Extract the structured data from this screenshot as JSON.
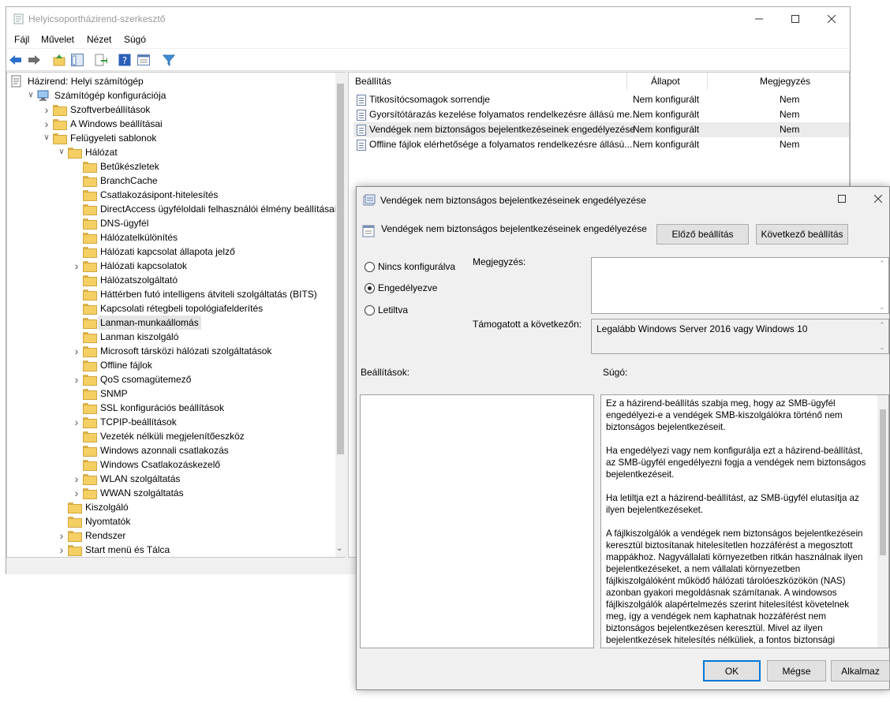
{
  "window": {
    "title": "Helyicsoportházirend-szerkesztő"
  },
  "menu": [
    "Fájl",
    "Művelet",
    "Nézet",
    "Súgó"
  ],
  "tree": {
    "root": "Házirend: Helyi számítógép",
    "computer_config": "Számítógép konfigurációja",
    "software": "Szoftverbeállítások",
    "windows_settings": "A Windows beállításai",
    "admin_templates": "Felügyeleti sablonok",
    "network": "Hálózat",
    "network_items": [
      "Betűkészletek",
      "BranchCache",
      "Csatlakozásipont-hitelesítés",
      "DirectAccess ügyféloldali felhasználói élmény beállításai",
      "DNS-ügyfél",
      "Hálózatelkülönítés",
      "Hálózati kapcsolat állapota jelző",
      "Hálózati kapcsolatok",
      "Hálózatszolgáltató",
      "Háttérben futó intelligens átviteli szolgáltatás (BITS)",
      "Kapcsolati rétegbeli topológiafelderítés",
      "Lanman-munkaállomás",
      "Lanman kiszolgáló",
      "Microsoft társközi hálózati szolgáltatások",
      "Offline fájlok",
      "QoS csomagütemező",
      "SNMP",
      "SSL konfigurációs beállítások",
      "TCPIP-beállítások",
      "Vezeték nélküli megjelenítőeszköz",
      "Windows azonnali csatlakozás",
      "Windows Csatlakozáskezelő",
      "WLAN szolgáltatás",
      "WWAN szolgáltatás"
    ],
    "after_network": [
      "Kiszolgáló",
      "Nyomtatók",
      "Rendszer",
      "Start menü és Tálca"
    ]
  },
  "list": {
    "headers": {
      "setting": "Beállítás",
      "state": "Állapot",
      "comment": "Megjegyzés"
    },
    "rows": [
      {
        "name": "Titkosítócsomagok sorrendje",
        "state": "Nem konfigurált",
        "comment": "Nem"
      },
      {
        "name": "Gyorsítótárazás kezelése folyamatos rendelkezésre állású me...",
        "state": "Nem konfigurált",
        "comment": "Nem"
      },
      {
        "name": "Vendégek nem biztonságos bejelentkezéseinek engedélyezése",
        "state": "Nem konfigurált",
        "comment": "Nem"
      },
      {
        "name": "Offline fájlok elérhetősége a folyamatos rendelkezésre állású...",
        "state": "Nem konfigurált",
        "comment": "Nem"
      }
    ]
  },
  "dialog": {
    "title": "Vendégek nem biztonságos bejelentkezéseinek engedélyezése",
    "heading": "Vendégek nem biztonságos bejelentkezéseinek engedélyezése",
    "prev_button": "Előző beállítás",
    "next_button": "Következő beállítás",
    "radio_not_configured": "Nincs konfigurálva",
    "radio_enabled": "Engedélyezve",
    "radio_disabled": "Letiltva",
    "comment_label": "Megjegyzés:",
    "supported_label": "Támogatott a következőn:",
    "supported_value": "Legalább Windows Server 2016 vagy Windows 10",
    "options_label": "Beállítások:",
    "help_label": "Súgó:",
    "help_text": "Ez a házirend-beállítás szabja meg, hogy az SMB-ügyfél engedélyezi-e a vendégek SMB-kiszolgálókra történő nem biztonságos bejelentkezéseit.\n\nHa engedélyezi vagy nem konfigurálja ezt a házirend-beállítást, az SMB-ügyfél engedélyezni fogja a vendégek nem biztonságos bejelentkezéseit.\n\nHa letiltja ezt a házirend-beállítást, az SMB-ügyfél elutasítja az ilyen bejelentkezéseket.\n\nA fájlkiszolgálók a vendégek nem biztonságos bejelentkezésein keresztül biztosítanak hitelesítetlen hozzáférést a megosztott mappákhoz. Nagyvállalati környezetben ritkán használnak ilyen bejelentkezéseket, a nem vállalati környezetben fájlkiszolgálóként működő hálózati tárolóeszközökön (NAS) azonban gyakori megoldásnak számítanak. A windowsos fájlkiszolgálók alapértelmezés szerint hitelesítést követelnek meg, így a vendégek nem kaphatnak hozzáférést nem biztonságos bejelentkezésen keresztül. Mivel az ilyen bejelentkezések hitelesítés nélküliek, a fontos biztonsági funkciók (köztük az",
    "ok": "OK",
    "cancel": "Mégse",
    "apply": "Alkalmaz"
  }
}
